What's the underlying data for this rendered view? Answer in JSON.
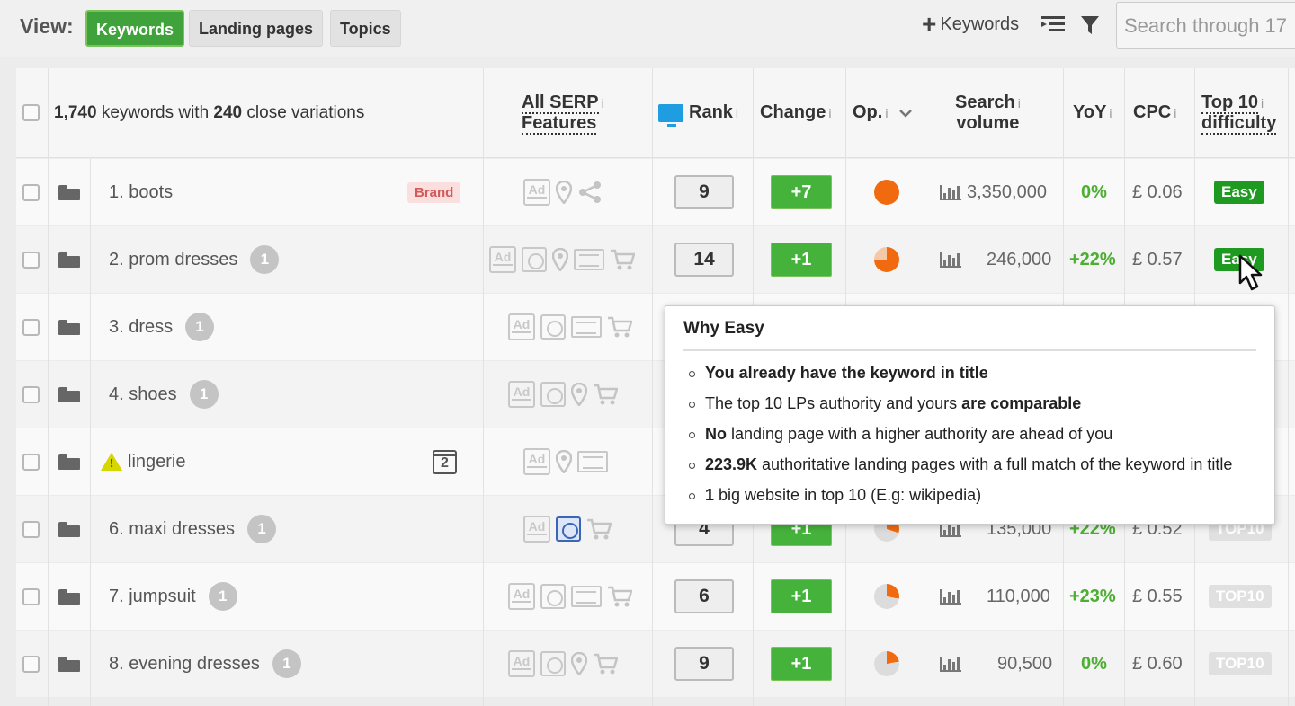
{
  "toolbar": {
    "view_label": "View:",
    "tabs": [
      "Keywords",
      "Landing pages",
      "Topics"
    ],
    "add_keywords": "Keywords",
    "search_placeholder": "Search through 17"
  },
  "header": {
    "count_a": "1,740",
    "count_text_a": " keywords with ",
    "count_b": "240",
    "count_text_b": " close variations",
    "serp_line1": "All SERP",
    "serp_line2": "Features",
    "rank": "Rank",
    "change": "Change",
    "op": "Op.",
    "volume_line1": "Search",
    "volume_line2": "volume",
    "yoy": "YoY",
    "cpc": "CPC",
    "difficulty_line1": "Top 10",
    "difficulty_line2": "difficulty",
    "info": "i"
  },
  "rows": [
    {
      "keyword": "1. boots",
      "badge": "Brand",
      "rank": "9",
      "change": "+7",
      "volume": "3,350,000",
      "yoy": "0%",
      "cpc": "£ 0.06",
      "difficulty": "Easy"
    },
    {
      "keyword": "2. prom dresses",
      "variations": "1",
      "rank": "14",
      "change": "+1",
      "volume": "246,000",
      "yoy": "+22%",
      "cpc": "£ 0.57",
      "difficulty": "Easy"
    },
    {
      "keyword": "3. dress",
      "variations": "1"
    },
    {
      "keyword": "4. shoes",
      "variations": "1"
    },
    {
      "keyword": "lingerie",
      "calendar": "2"
    },
    {
      "keyword": "6. maxi dresses",
      "variations": "1",
      "rank": "4",
      "change": "+1",
      "volume": "135,000",
      "yoy": "+22%",
      "cpc": "£ 0.52",
      "difficulty": "TOP10"
    },
    {
      "keyword": "7. jumpsuit",
      "variations": "1",
      "rank": "6",
      "change": "+1",
      "volume": "110,000",
      "yoy": "+23%",
      "cpc": "£ 0.55",
      "difficulty": "TOP10"
    },
    {
      "keyword": "8. evening dresses",
      "variations": "1",
      "rank": "9",
      "change": "+1",
      "volume": "90,500",
      "yoy": "0%",
      "cpc": "£ 0.60",
      "difficulty": "TOP10"
    }
  ],
  "tooltip": {
    "title": "Why Easy",
    "l1_b": "You already have the keyword in title",
    "l2_a": "The top 10 LPs authority and yours ",
    "l2_b": "are comparable",
    "l3_b": "No",
    "l3_a": " landing page with a higher authority are ahead of you",
    "l4_b": "223.9K",
    "l4_a": " authoritative landing pages with a full match of the keyword in title",
    "l5_b": "1",
    "l5_a": " big website in top 10 (E.g: wikipedia)"
  },
  "colors": {
    "accent_green": "#3fa23a",
    "easy": "#1f9a20",
    "yoy_green": "#4caf32",
    "pie_orange": "#f26a0f"
  }
}
